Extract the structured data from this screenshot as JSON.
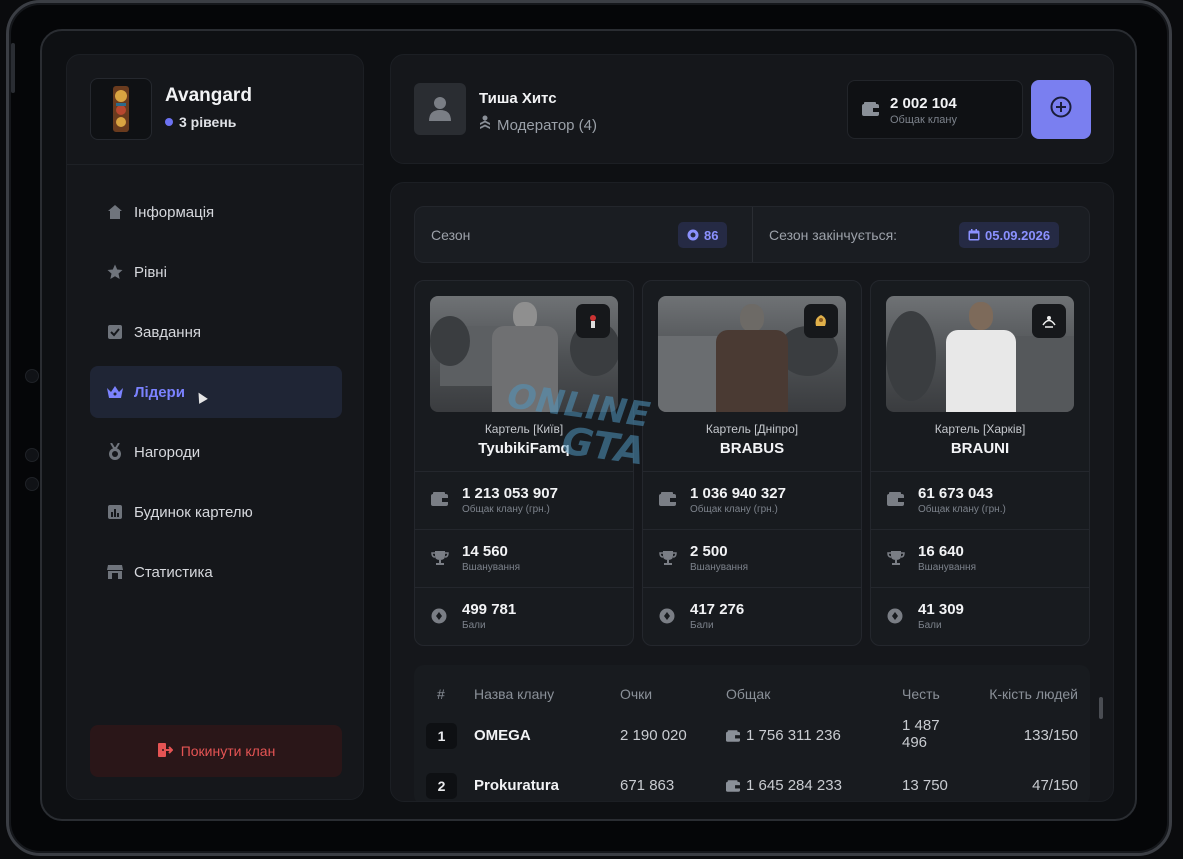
{
  "clan": {
    "name": "Avangard",
    "level": "3 рівень"
  },
  "nav": [
    {
      "label": "Інформація",
      "icon": "home-icon",
      "active": false
    },
    {
      "label": "Рівні",
      "icon": "star-icon",
      "active": false
    },
    {
      "label": "Завдання",
      "icon": "task-check-icon",
      "active": false
    },
    {
      "label": "Лідери",
      "icon": "crown-icon",
      "active": true
    },
    {
      "label": "Нагороди",
      "icon": "medal-icon",
      "active": false
    },
    {
      "label": "Будинок картелю",
      "icon": "chart-building-icon",
      "active": false
    },
    {
      "label": "Статистика",
      "icon": "shop-icon",
      "active": false
    }
  ],
  "leave_label": "Покинути клан",
  "user": {
    "name": "Тиша Хитс",
    "role": "Модератор (4)"
  },
  "wallet": {
    "value": "2 002 104",
    "label": "Общак клану"
  },
  "season": {
    "label": "Сезон",
    "number": "86",
    "ends_label": "Сезон закінчується:",
    "ends_date": "05.09.2026"
  },
  "leaders": [
    {
      "city": "Картель [Київ]",
      "name": "TyubikiFamq",
      "money": "1 213 053 907",
      "money_label": "Общак клану (грн.)",
      "honor": "14 560",
      "honor_label": "Вшанування",
      "points": "499 781",
      "points_label": "Бали"
    },
    {
      "city": "Картель [Дніпро]",
      "name": "BRABUS",
      "money": "1 036 940 327",
      "money_label": "Общак клану (грн.)",
      "honor": "2 500",
      "honor_label": "Вшанування",
      "points": "417 276",
      "points_label": "Бали"
    },
    {
      "city": "Картель [Харків]",
      "name": "BRAUNI",
      "money": "61 673 043",
      "money_label": "Общак клану (грн.)",
      "honor": "16 640",
      "honor_label": "Вшанування",
      "points": "41 309",
      "points_label": "Бали"
    }
  ],
  "table": {
    "headers": [
      "#",
      "Назва клану",
      "Очки",
      "Общак",
      "Честь",
      "К-кість людей"
    ],
    "rows": [
      {
        "rank": "1",
        "name": "OMEGA",
        "points": "2 190 020",
        "money": "1 756 311 236",
        "honor": "1 487 496",
        "members": "133/150"
      },
      {
        "rank": "2",
        "name": "Prokuratura",
        "points": "671 863",
        "money": "1 645 284 233",
        "honor": "13 750",
        "members": "47/150"
      }
    ]
  },
  "watermark": {
    "line1": "ONLINE",
    "line2": "GTA"
  },
  "colors": {
    "accent": "#7a7ff0",
    "danger": "#e55454",
    "panel": "#15171b"
  }
}
